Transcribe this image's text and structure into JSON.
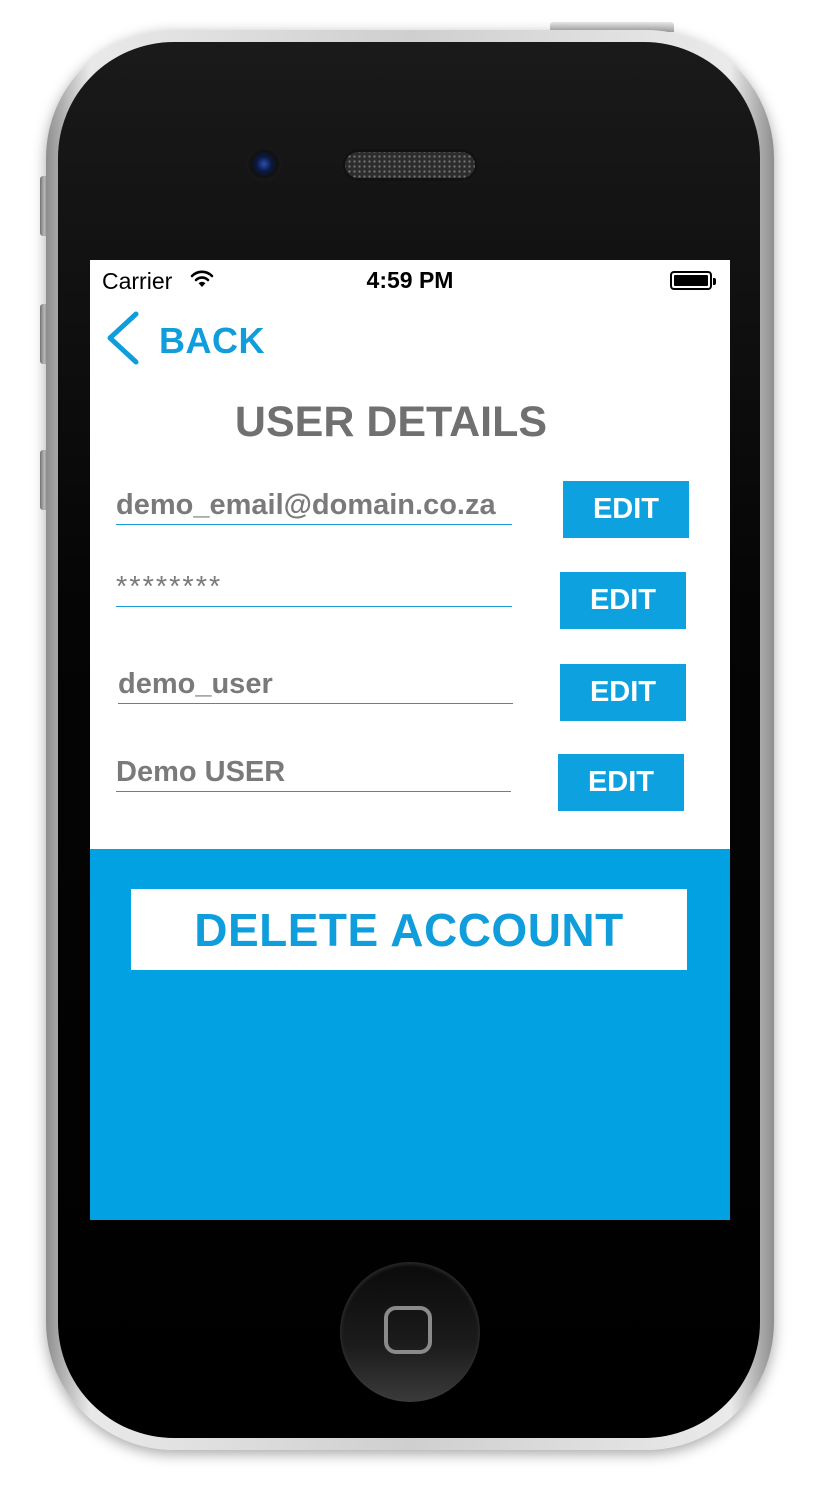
{
  "status_bar": {
    "carrier": "Carrier",
    "time": "4:59 PM"
  },
  "nav": {
    "back_label": "BACK"
  },
  "page": {
    "title": "USER DETAILS"
  },
  "fields": [
    {
      "value": "demo_email@domain.co.za",
      "edit_label": "EDIT"
    },
    {
      "value": "********",
      "edit_label": "EDIT"
    },
    {
      "value": "demo_user",
      "edit_label": "EDIT"
    },
    {
      "value": "Demo USER",
      "edit_label": "EDIT"
    }
  ],
  "actions": {
    "delete_label": "DELETE ACCOUNT"
  },
  "colors": {
    "accent": "#02a2e2",
    "title_gray": "#707070",
    "field_text": "#7a7a7a"
  },
  "icons": {
    "back": "chevron-left-icon",
    "wifi": "wifi-icon",
    "battery": "battery-icon"
  }
}
